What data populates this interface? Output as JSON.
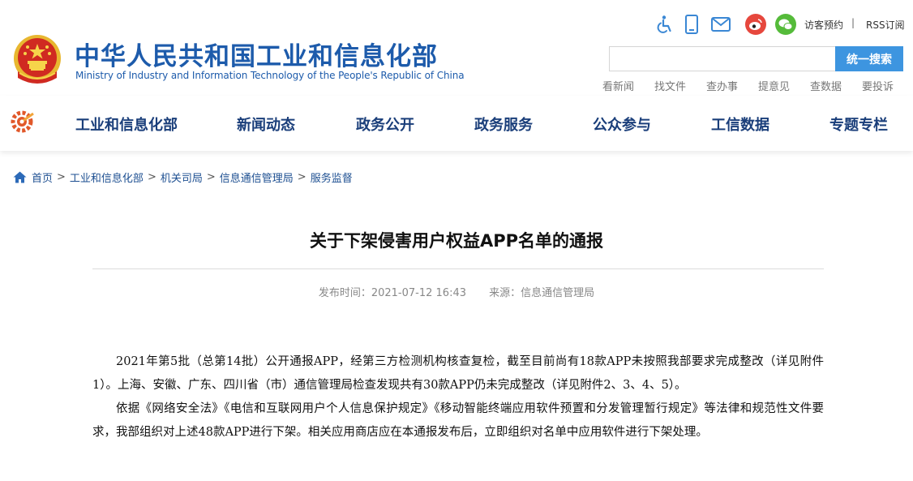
{
  "header": {
    "title_cn": "中华人民共和国工业和信息化部",
    "title_en": "Ministry of Industry and Information Technology of the People's Republic of China",
    "tools": {
      "visit_label": "访客预约",
      "separator": "|",
      "rss_label": "RSS订阅"
    },
    "search": {
      "placeholder": "",
      "button_label": "统一搜索"
    },
    "quick_links": [
      "看新闻",
      "找文件",
      "查办事",
      "提意见",
      "查数据",
      "要投诉"
    ]
  },
  "nav": {
    "items": [
      "工业和信息化部",
      "新闻动态",
      "政务公开",
      "政务服务",
      "公众参与",
      "工信数据",
      "专题专栏"
    ]
  },
  "breadcrumb": {
    "items": [
      "首页",
      "工业和信息化部",
      "机关司局",
      "信息通信管理局",
      "服务监督"
    ],
    "separator": ">"
  },
  "article": {
    "title": "关于下架侵害用户权益APP名单的通报",
    "publish_time": "发布时间：2021-07-12 16:43",
    "source": "来源：信息通信管理局",
    "paragraphs": [
      "2021年第5批（总第14批）公开通报APP，经第三方检测机构核查复检，截至目前尚有18款APP未按照我部要求完成整改（详见附件1）。上海、安徽、广东、四川省（市）通信管理局检查发现共有30款APP仍未完成整改（详见附件2、3、4、5）。",
      "依据《网络安全法》《电信和互联网用户个人信息保护规定》《移动智能终端应用软件预置和分发管理暂行规定》等法律和规范性文件要求，我部组织对上述48款APP进行下架。相关应用商店应在本通报发布后，立即组织对名单中应用软件进行下架处理。"
    ]
  },
  "colors": {
    "brand_blue": "#1d5bab",
    "nav_text": "#1a3e7a",
    "search_button": "#3d95e0",
    "weibo_red": "#e6473d",
    "wechat_green": "#55bb3a"
  },
  "icons": [
    "accessibility-icon",
    "mobile-icon",
    "mail-icon",
    "weibo-icon",
    "wechat-icon",
    "home-icon",
    "national-emblem",
    "miit-logo"
  ]
}
